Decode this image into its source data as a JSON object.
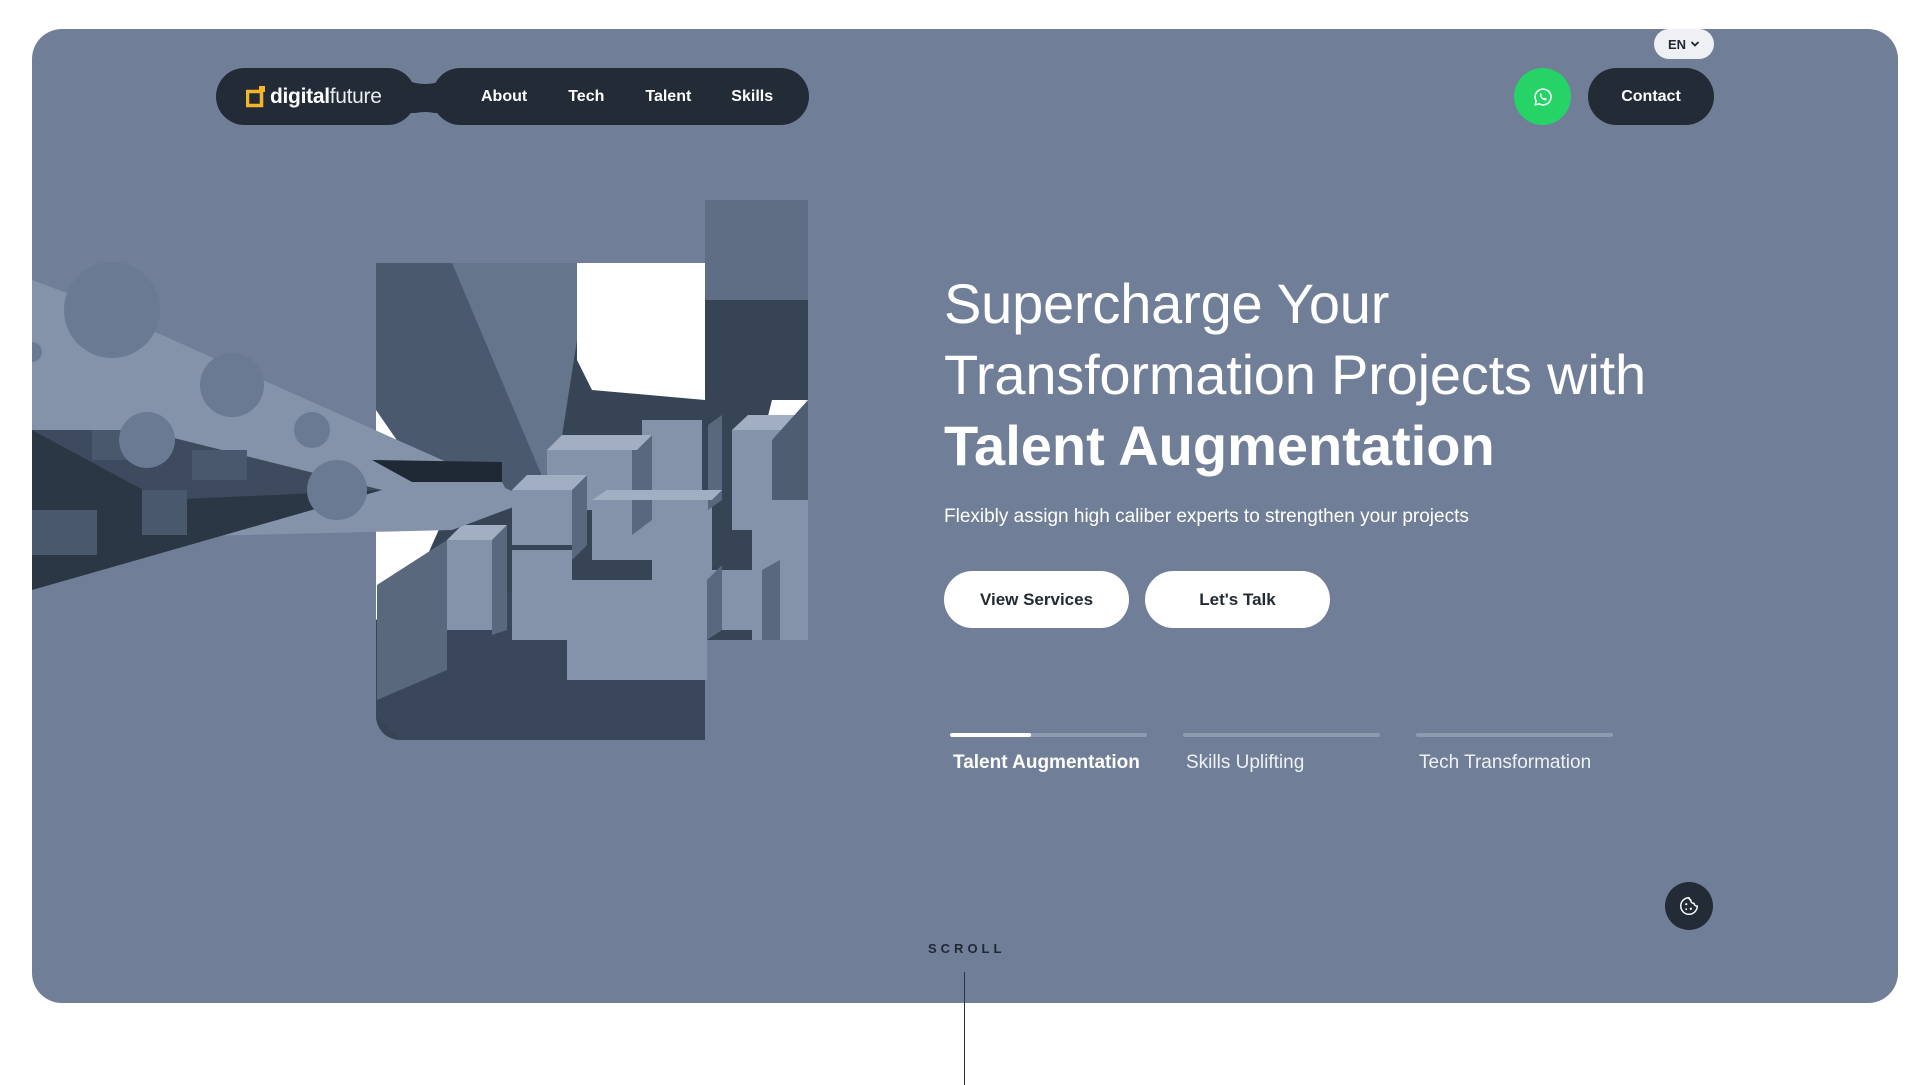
{
  "language": {
    "selected": "EN"
  },
  "logo": {
    "bold": "digital",
    "light": "future"
  },
  "nav": {
    "items": [
      "About",
      "Tech",
      "Talent",
      "Skills"
    ]
  },
  "header": {
    "contact_label": "Contact",
    "whatsapp_icon": "whatsapp-icon"
  },
  "hero": {
    "line1": "Supercharge Your",
    "line2": "Transformation Projects with",
    "line3": "Talent Augmentation",
    "subtitle": "Flexibly assign high caliber experts to strengthen your projects",
    "primary_button": "View Services",
    "secondary_button": "Let's Talk"
  },
  "tabs": [
    {
      "label": "Talent Augmentation",
      "active": true,
      "progress": 0.41
    },
    {
      "label": "Skills Uplifting",
      "active": false,
      "progress": 0
    },
    {
      "label": "Tech Transformation",
      "active": false,
      "progress": 0
    }
  ],
  "scroll": {
    "label": "SCROLL"
  },
  "colors": {
    "hero_bg": "#707f97",
    "dark": "#222b36",
    "accent_logo": "#f5b52b",
    "whatsapp": "#25d366"
  }
}
